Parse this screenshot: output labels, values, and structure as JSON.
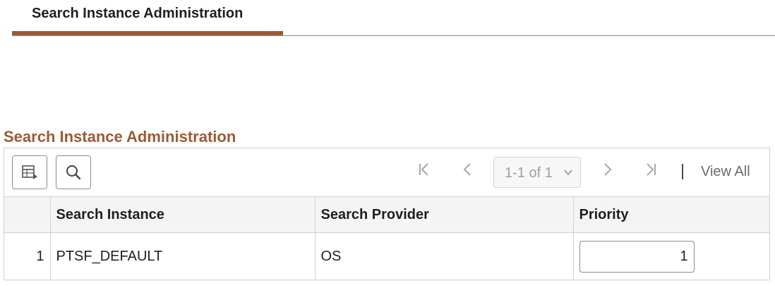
{
  "tabs": [
    {
      "label": "Search Instance Administration",
      "active": true
    }
  ],
  "grid": {
    "title": "Search Instance Administration",
    "toolbar": {
      "personalize_icon": "grid-personalize-icon",
      "find_icon": "search-icon",
      "first_icon": "first-page-icon",
      "prev_icon": "previous-page-icon",
      "next_icon": "next-page-icon",
      "last_icon": "last-page-icon",
      "pager_value": "1-1 of 1",
      "view_all": "View All"
    },
    "columns": [
      "",
      "Search Instance",
      "Search Provider",
      "Priority"
    ],
    "rows": [
      {
        "num": "1",
        "instance": "PTSF_DEFAULT",
        "provider": "OS",
        "priority": "1"
      }
    ]
  },
  "colors": {
    "accent": "#9c5a36",
    "border": "#d0d0d0",
    "header_bg": "#f4f4f4"
  }
}
